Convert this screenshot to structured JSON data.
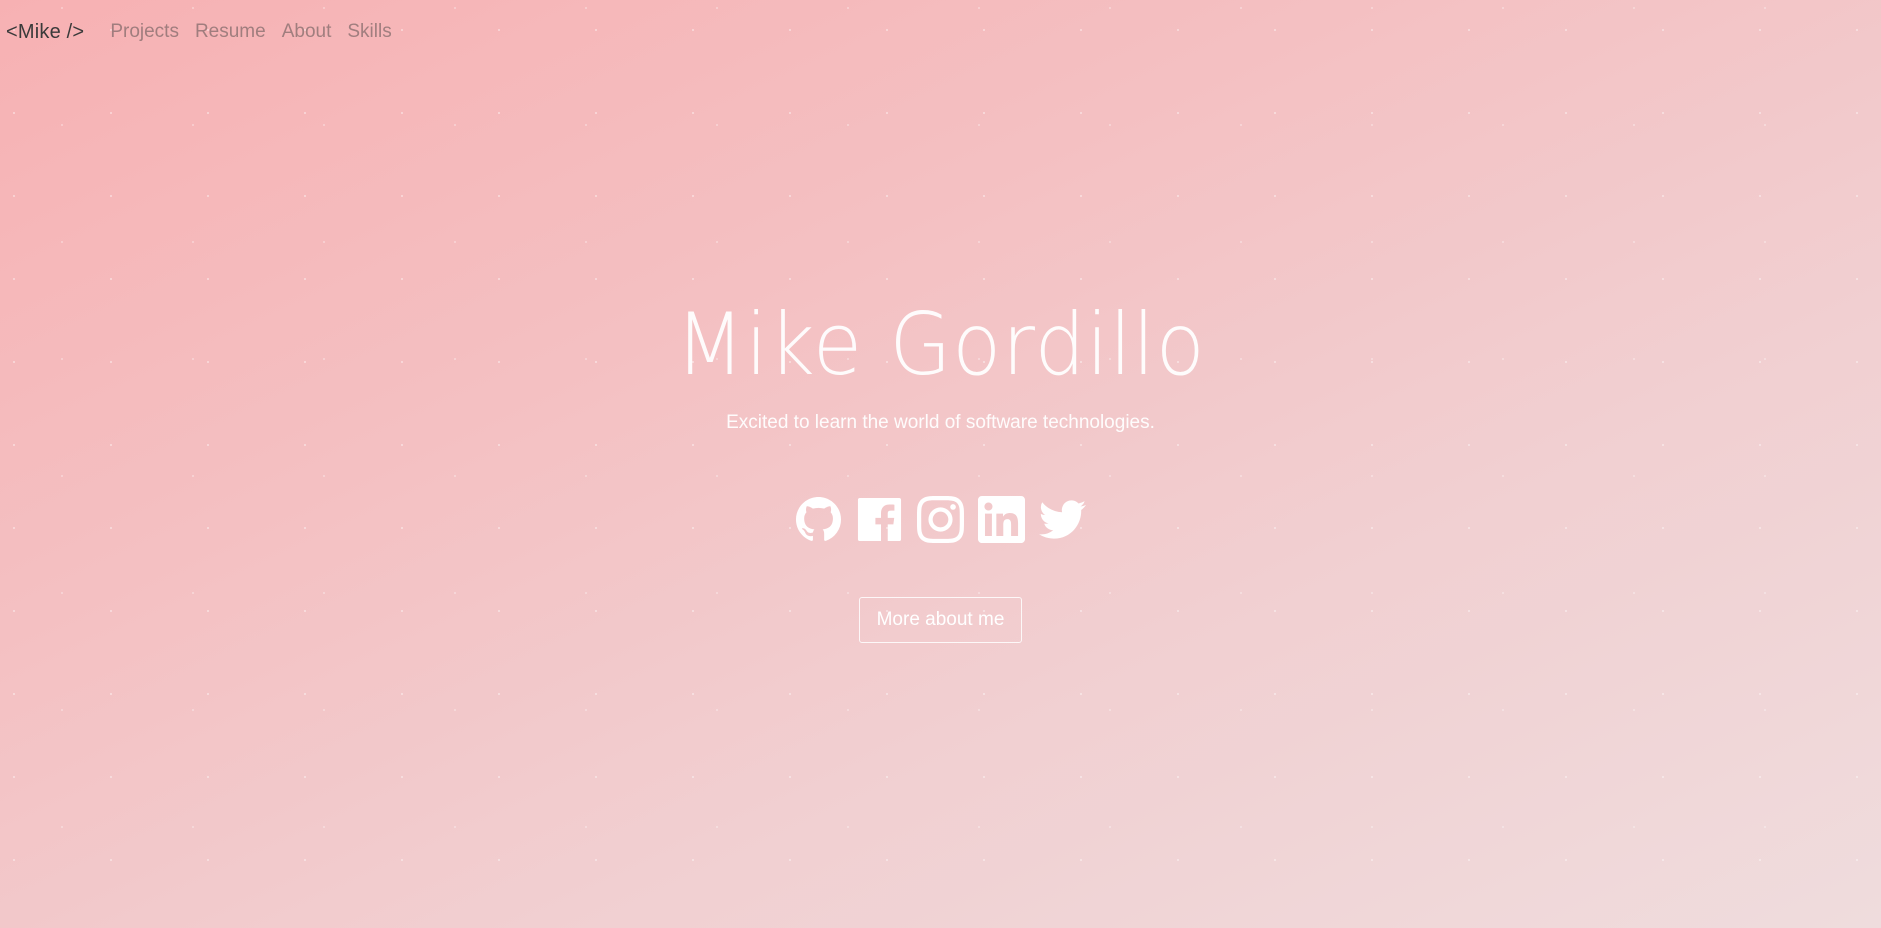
{
  "nav": {
    "brand": "<Mike />",
    "links": [
      {
        "label": "Projects"
      },
      {
        "label": "Resume"
      },
      {
        "label": "About"
      },
      {
        "label": "Skills"
      }
    ]
  },
  "hero": {
    "name": "Mike Gordillo",
    "tagline": "Excited to learn the world of software technologies.",
    "cta_label": "More about me"
  },
  "socials": [
    {
      "icon": "github-icon"
    },
    {
      "icon": "facebook-icon"
    },
    {
      "icon": "instagram-icon"
    },
    {
      "icon": "linkedin-icon"
    },
    {
      "icon": "twitter-icon"
    }
  ],
  "colors": {
    "gradient_start": "#f7b1b3",
    "gradient_end": "#efdcdd",
    "text": "#ffffff"
  }
}
